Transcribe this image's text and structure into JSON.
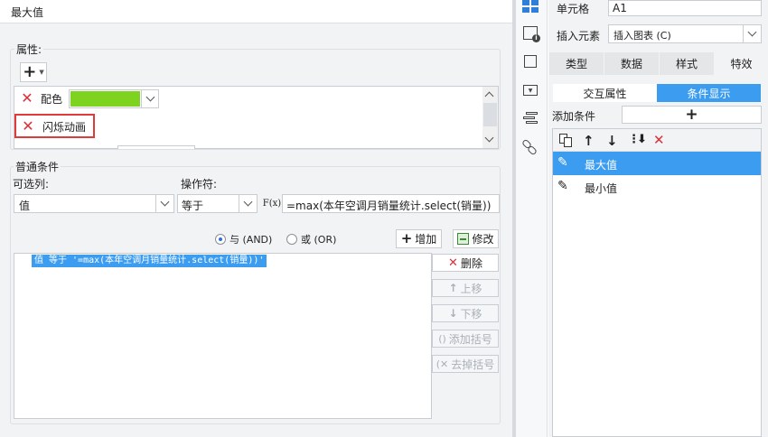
{
  "dialog": {
    "title": "最大值",
    "properties": {
      "group_label": "属性:",
      "add_button_label": "+",
      "items": [
        {
          "label": "配色",
          "color": "#7ed321"
        },
        {
          "label": "闪烁动画"
        }
      ]
    },
    "conditions": {
      "group_label": "普通条件",
      "column_label": "可选列:",
      "column_value": "值",
      "operator_label": "操作符:",
      "operator_value": "等于",
      "formula_icon_label": "F(x)",
      "formula_value": "=max(本年空调月销量统计.select(销量))",
      "and_label": "与 (AND)",
      "or_label": "或 (OR)",
      "add_label": "增加",
      "modify_label": "修改",
      "list_item": "值 等于 '=max(本年空调月销量统计.select(销量))'",
      "side_buttons": {
        "delete": "删除",
        "up": "上移",
        "down": "下移",
        "add_bracket": "添加括号",
        "remove_bracket": "去掉括号"
      }
    }
  },
  "right_panel": {
    "cell_label": "单元格",
    "cell_value": "A1",
    "insert_label": "插入元素",
    "insert_value": "插入图表 (C)",
    "tabs": [
      "类型",
      "数据",
      "样式",
      "特效"
    ],
    "subtabs": [
      "交互属性",
      "条件显示"
    ],
    "add_condition_label": "添加条件",
    "add_condition_button": "+",
    "conditions": [
      "最大值",
      "最小值"
    ],
    "accent_color": "#3c9cf0"
  }
}
